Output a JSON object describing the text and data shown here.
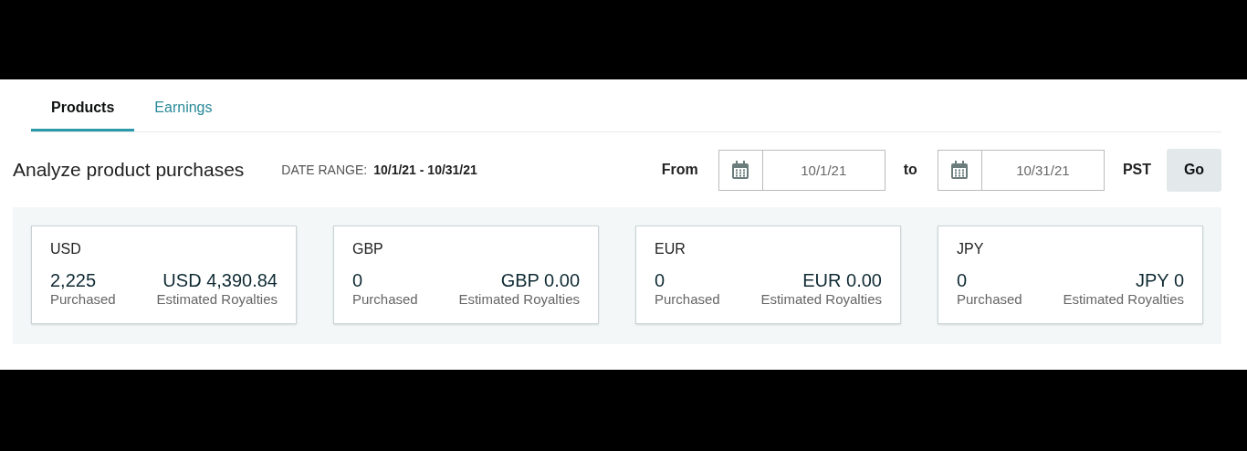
{
  "tabs": [
    {
      "label": "Products",
      "selected": true
    },
    {
      "label": "Earnings",
      "selected": false
    }
  ],
  "header": {
    "title": "Analyze product purchases",
    "range_label": "DATE RANGE:",
    "range_value": "10/1/21 - 10/31/21"
  },
  "date_filter": {
    "from_label": "From",
    "from_value": "10/1/21",
    "to_label": "to",
    "to_value": "10/31/21",
    "timezone": "PST",
    "go_button": "Go"
  },
  "cards": [
    {
      "currency": "USD",
      "purchased": "2,225",
      "purchased_label": "Purchased",
      "royalties": "USD 4,390.84",
      "royalties_label": "Estimated Royalties"
    },
    {
      "currency": "GBP",
      "purchased": "0",
      "purchased_label": "Purchased",
      "royalties": "GBP 0.00",
      "royalties_label": "Estimated Royalties"
    },
    {
      "currency": "EUR",
      "purchased": "0",
      "purchased_label": "Purchased",
      "royalties": "EUR 0.00",
      "royalties_label": "Estimated Royalties"
    },
    {
      "currency": "JPY",
      "purchased": "0",
      "purchased_label": "Purchased",
      "royalties": "JPY 0",
      "royalties_label": "Estimated Royalties"
    }
  ]
}
